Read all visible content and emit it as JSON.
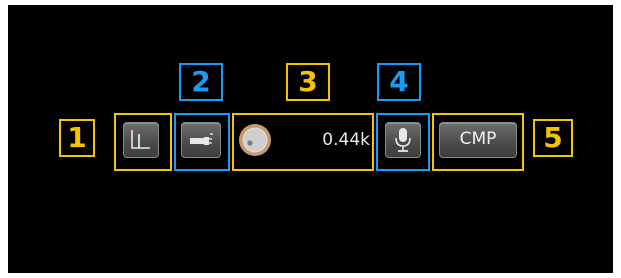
{
  "callouts": [
    {
      "label": "1",
      "color": "#f5c400"
    },
    {
      "label": "2",
      "color": "#1a9cf0"
    },
    {
      "label": "3",
      "color": "#f5c400"
    },
    {
      "label": "4",
      "color": "#1a9cf0"
    },
    {
      "label": "5",
      "color": "#f5c400"
    }
  ],
  "controls": {
    "spectrum_button": {
      "icon": "spectrum-peak-icon"
    },
    "audio_source_button": {
      "icon": "audio-plug-icon"
    },
    "knob": {
      "icon": "volume-knob-icon",
      "value_text": "0.44k"
    },
    "mic_button": {
      "icon": "microphone-icon"
    },
    "compressor_button": {
      "label": "CMP"
    }
  },
  "colors": {
    "background": "#000000",
    "accent_yellow": "#f5c400",
    "accent_blue": "#1a9cf0",
    "knob_ring": "#c89a6a"
  }
}
